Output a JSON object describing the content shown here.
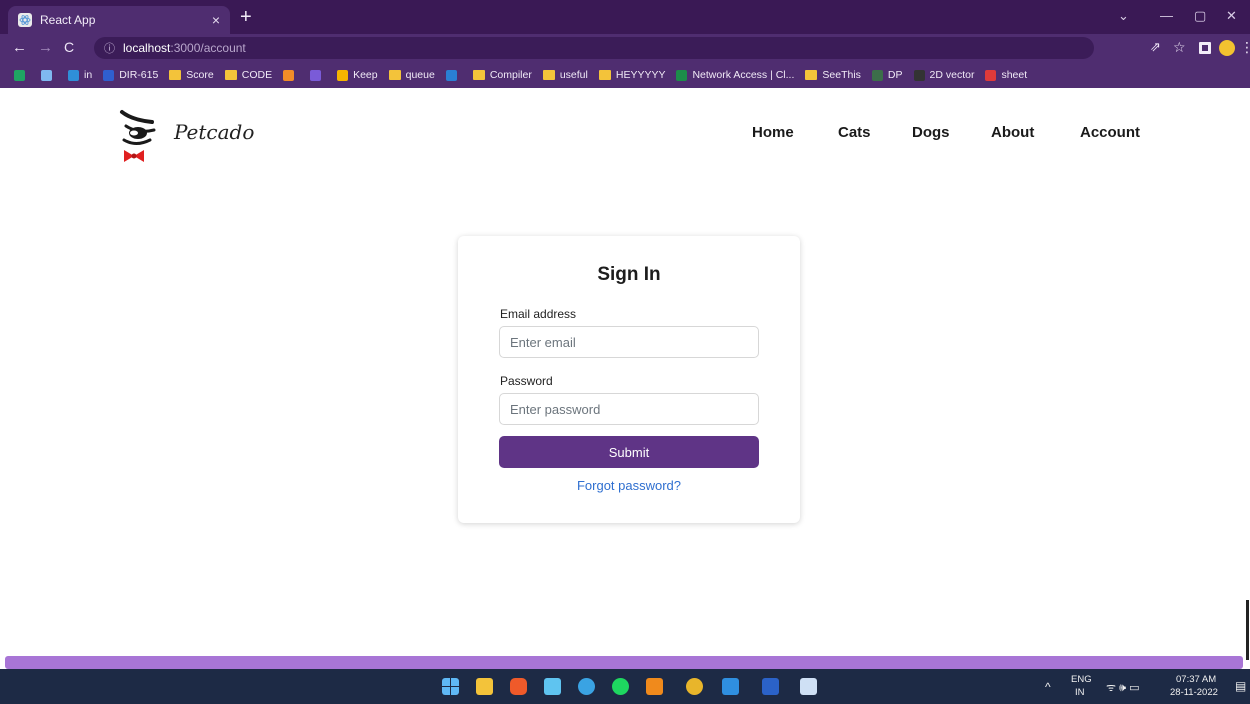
{
  "browser": {
    "tab_title": "React App",
    "tab_close": "×",
    "new_tab": "+",
    "url_host": "localhost",
    "url_path": ":3000/account",
    "info_glyph": "ⓘ",
    "window_controls": [
      "⌄",
      "—",
      "▢",
      "✕"
    ],
    "bookmarks": [
      {
        "icon": "drive-icon",
        "label": "",
        "color": "#1fa463"
      },
      {
        "icon": "cloud-icon",
        "label": "",
        "color": "#7fb8f0"
      },
      {
        "icon": "linkedin-icon",
        "label": "in",
        "color": "#2f8fd8"
      },
      {
        "icon": "d-icon",
        "label": "DIR-615",
        "color": "#2f5fd0"
      },
      {
        "icon": "folder-icon",
        "label": "Score",
        "color": "#f3c33a"
      },
      {
        "icon": "folder-icon",
        "label": "CODE",
        "color": "#f3c33a"
      },
      {
        "icon": "code-icon",
        "label": "",
        "color": "#f28c28"
      },
      {
        "icon": "u-icon",
        "label": "",
        "color": "#7a5bd8"
      },
      {
        "icon": "keep-icon",
        "label": "Keep",
        "color": "#f6b400"
      },
      {
        "icon": "folder-icon",
        "label": "queue",
        "color": "#f3c33a"
      },
      {
        "icon": "phone-icon",
        "label": "",
        "color": "#2a7fd4"
      },
      {
        "icon": "folder-icon",
        "label": "Compiler",
        "color": "#f3c33a"
      },
      {
        "icon": "folder-icon",
        "label": "useful",
        "color": "#f3c33a"
      },
      {
        "icon": "folder-icon",
        "label": "HEYYYYY",
        "color": "#f3c33a"
      },
      {
        "icon": "network-icon",
        "label": "Network Access | Cl...",
        "color": "#1c8c4a"
      },
      {
        "icon": "folder-icon",
        "label": "SeeThis",
        "color": "#f3c33a"
      },
      {
        "icon": "dp-icon",
        "label": "DP",
        "color": "#3c6e4a"
      },
      {
        "icon": "td-icon",
        "label": "2D vector",
        "color": "#333333"
      },
      {
        "icon": "sheet-icon",
        "label": "sheet",
        "color": "#e03a3a"
      }
    ]
  },
  "site": {
    "brand": "Petcado",
    "nav": [
      "Home",
      "Cats",
      "Dogs",
      "About",
      "Account"
    ]
  },
  "signin": {
    "title": "Sign In",
    "email_label": "Email address",
    "email_placeholder": "Enter email",
    "password_label": "Password",
    "password_placeholder": "Enter password",
    "submit_label": "Submit",
    "forgot_label": "Forgot password?"
  },
  "taskbar": {
    "lang_top": "ENG",
    "lang_bottom": "IN",
    "time": "07:37 AM",
    "date": "28-11-2022",
    "up_arrow": "^",
    "tray_icons": "ᯤ 🕪 ▭"
  },
  "colors": {
    "accent": "#5f3486",
    "chrome": "#3a1955",
    "link": "#2f6fd0"
  }
}
